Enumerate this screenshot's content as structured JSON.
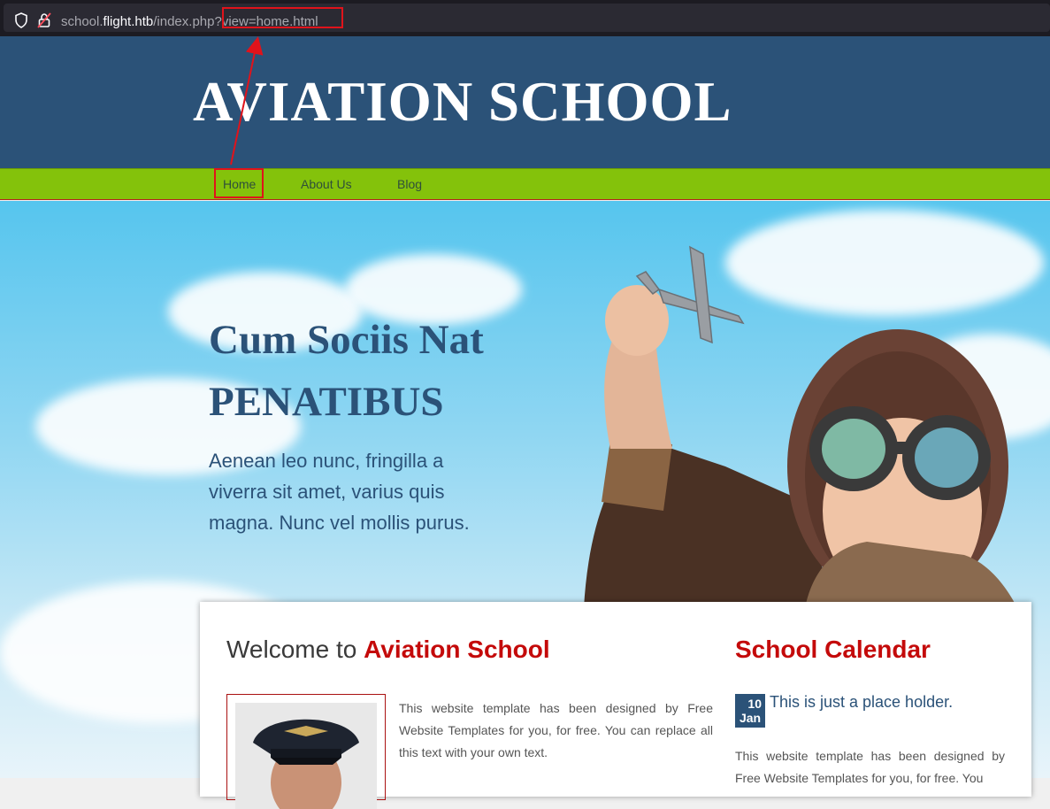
{
  "browser": {
    "url_prefix": "school.",
    "url_host": "flight.htb",
    "url_path": "/index.php",
    "url_query": "?view=home.html"
  },
  "header": {
    "site_title": "AVIATION SCHOOL"
  },
  "nav": {
    "items": [
      {
        "label": "Home"
      },
      {
        "label": "About Us"
      },
      {
        "label": "Blog"
      }
    ]
  },
  "hero": {
    "title_line1": "Cum Sociis Nat",
    "title_line2": "PENATIBUS",
    "text": "Aenean leo nunc, fringilla a viverra sit amet, varius quis magna. Nunc vel mollis purus."
  },
  "main": {
    "welcome_prefix": "Welcome to ",
    "welcome_brand": "Aviation School",
    "body_text": "This website template has been designed by Free Website Templates for you, for free. You can replace all this text with your own text."
  },
  "calendar": {
    "title": "School Calendar",
    "date_day": "10",
    "date_month": "Jan",
    "item_title": "This is just a place holder.",
    "item_text": "This website template has been designed by Free Website Templates for you, for free. You"
  },
  "colors": {
    "header_bg": "#2b5278",
    "nav_bg": "#84c20b",
    "accent_red": "#c40a0a",
    "annotation_red": "#e0131b"
  }
}
